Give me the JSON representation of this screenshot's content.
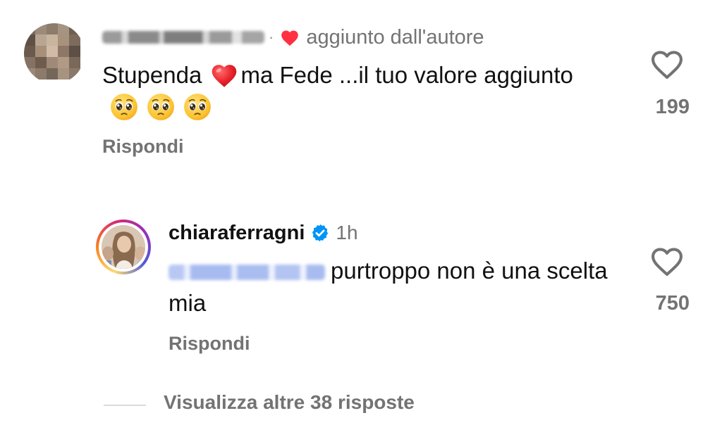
{
  "comment": {
    "author_name_redacted": "",
    "time_redacted": "",
    "author_like_label": "aggiunto dall'autore",
    "text_before_heart": "Stupenda ",
    "text_after_heart": "ma Fede ...il tuo valore aggiunto",
    "emoji_face_count": 3,
    "reply_label": "Rispondi",
    "like_count": "199"
  },
  "reply": {
    "username": "chiaraferragni",
    "time": "1h",
    "mention_redacted": "",
    "text": "purtroppo non è una scelta mia",
    "reply_label": "Rispondi",
    "like_count": "750"
  },
  "view_more": {
    "label": "Visualizza altre 38 risposte"
  },
  "colors": {
    "like_red": "#ff3040",
    "secondary_text": "#737373",
    "verified_blue": "#0095f6"
  },
  "icons": {
    "like": "heart-outline-icon",
    "author_like": "heart-filled-icon",
    "verified": "verified-badge-icon",
    "emoji_heart": "red-heart-emoji",
    "emoji_face": "pleading-face-emoji"
  }
}
